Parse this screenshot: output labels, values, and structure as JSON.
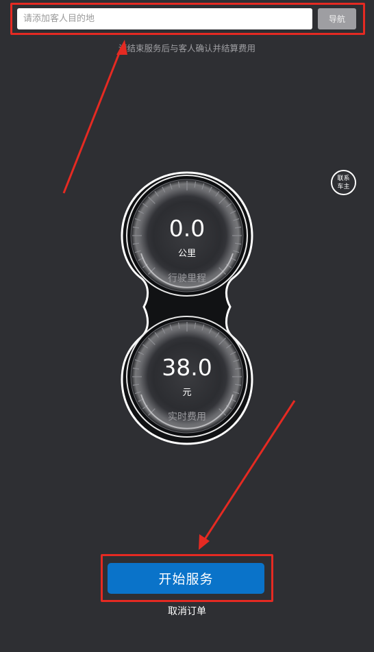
{
  "destination": {
    "placeholder": "请添加客人目的地",
    "value": "",
    "nav_label": "导航"
  },
  "hint": "请结束服务后与客人确认并结算费用",
  "contact": {
    "line1": "联系",
    "line2": "车主"
  },
  "gauges": {
    "distance": {
      "value": "0.0",
      "unit": "公里",
      "label": "行驶里程"
    },
    "fare": {
      "value": "38.0",
      "unit": "元",
      "label": "实时费用"
    }
  },
  "actions": {
    "start_label": "开始服务",
    "cancel_label": "取消订单"
  },
  "colors": {
    "background": "#2e2f33",
    "annotation_red": "#e52a22",
    "primary_blue": "#0a73c9",
    "nav_gray": "#9e9ea2"
  }
}
